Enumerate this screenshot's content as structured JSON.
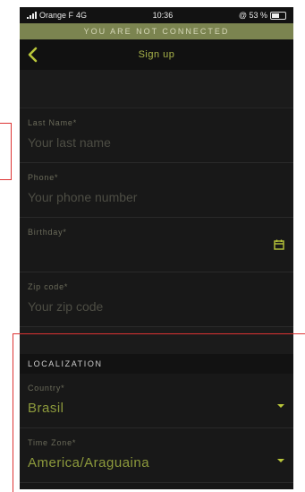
{
  "status": {
    "carrier": "Orange F",
    "network": "4G",
    "time": "10:36",
    "battery": "@ 53 %"
  },
  "banner": "YOU ARE NOT CONNECTED",
  "nav": {
    "title": "Sign up"
  },
  "fields": [
    {
      "label": "Last Name",
      "placeholder": "Your last name"
    },
    {
      "label": "Phone",
      "placeholder": "Your phone number"
    },
    {
      "label": "Birthday",
      "placeholder": ""
    },
    {
      "label": "Zip code",
      "placeholder": "Your zip code"
    }
  ],
  "localization": {
    "header": "LOCALIZATION",
    "country": {
      "label": "Country",
      "value": "Brasil"
    },
    "timezone": {
      "label": "Time Zone",
      "value": "America/Araguaina"
    }
  },
  "colors": {
    "accent": "#b9c63a",
    "banner": "#7b8450",
    "background": "#161616",
    "annotation": "#dd3333"
  }
}
